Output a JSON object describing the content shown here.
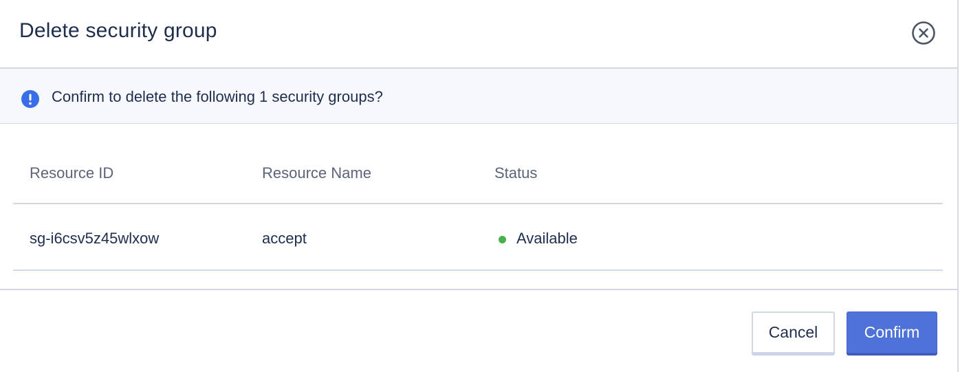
{
  "dialog": {
    "title": "Delete security group",
    "close_icon": "close-circle-icon"
  },
  "notice": {
    "icon": "exclamation-circle-icon",
    "text": "Confirm to delete the following 1 security groups?",
    "icon_color": "#3a6ee8"
  },
  "table": {
    "columns": [
      "Resource ID",
      "Resource Name",
      "Status"
    ],
    "rows": [
      {
        "resource_id": "sg-i6csv5z45wlxow",
        "resource_name": "accept",
        "status": "Available",
        "status_color": "#47b14a"
      }
    ]
  },
  "footer": {
    "cancel_label": "Cancel",
    "confirm_label": "Confirm",
    "confirm_color": "#4f72d8"
  }
}
